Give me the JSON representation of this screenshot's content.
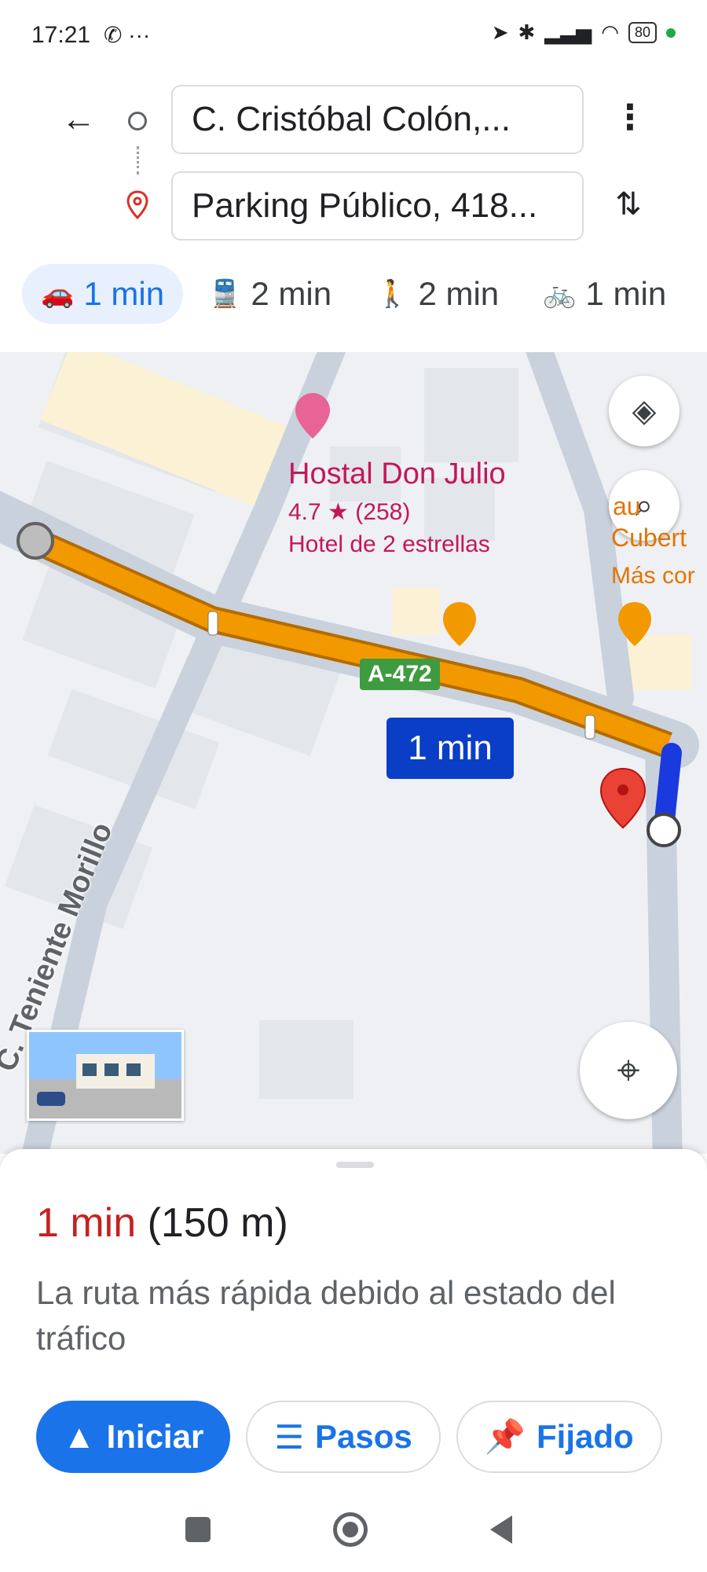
{
  "status_bar": {
    "time": "17:21",
    "left_icons": "✆ ···",
    "battery": "80"
  },
  "directions": {
    "origin": "C. Cristóbal Colón,...",
    "destination": "Parking Público, 418..."
  },
  "modes": [
    {
      "icon": "car-icon",
      "glyph": "🚗",
      "label": "1 min",
      "active": true
    },
    {
      "icon": "transit-icon",
      "glyph": "🚆",
      "label": "2 min"
    },
    {
      "icon": "walk-icon",
      "glyph": "🚶",
      "label": "2 min"
    },
    {
      "icon": "bike-icon",
      "glyph": "🚲",
      "label": "1 min"
    }
  ],
  "map": {
    "poi": {
      "name": "Hostal Don Julio",
      "rating": "4.7 ★ (258)",
      "category": "Hotel de 2 estrellas"
    },
    "poi_partial": {
      "line1": "au",
      "line2": "Cubert",
      "line3": "Más cor"
    },
    "road_badge": "A-472",
    "route_time": "1 min",
    "street_name": "C. Teniente Morillo"
  },
  "sheet": {
    "time": "1 min",
    "distance": "(150 m)",
    "description": "La ruta más rápida debido al estado del tráfico",
    "buttons": {
      "start": "Iniciar",
      "steps": "Pasos",
      "pinned": "Fijado"
    }
  },
  "colors": {
    "accent": "#1a73e8",
    "route": "#f29900",
    "poi_pink": "#c2185b",
    "time_red": "#c5221f"
  }
}
